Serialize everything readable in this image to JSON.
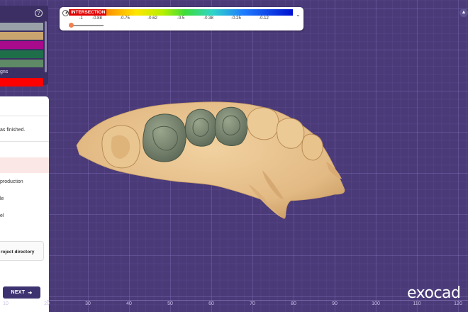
{
  "layer_panel": {
    "swatch_colors": [
      "#9aa0a8",
      "#c9a46e",
      "#a80a8c",
      "#1f6e4a",
      "#5e8a66"
    ],
    "label": "gns",
    "active_color": "#ff0000",
    "help_icon": "question-circle-icon"
  },
  "legend": {
    "title": "INTERSECTION",
    "ticks": [
      "-1",
      "-0.88",
      "-0.75",
      "-0.62",
      "-0.5",
      "-0.38",
      "-0.25",
      "-0.12"
    ],
    "icon": "gauge-icon",
    "collapse_icon": "chevron-down-icon"
  },
  "workflow": {
    "message": "as finished.",
    "items": [
      "production",
      "le",
      "el"
    ],
    "directory_button": "roject directory",
    "next_button": "NEXT",
    "next_icon": "arrow-right-icon"
  },
  "viewport": {
    "ruler": [
      "20",
      "30",
      "40",
      "50",
      "60",
      "70",
      "80",
      "90",
      "100",
      "110",
      "120",
      "10"
    ],
    "brand": "exocad",
    "corner_icon": "home-icon"
  }
}
